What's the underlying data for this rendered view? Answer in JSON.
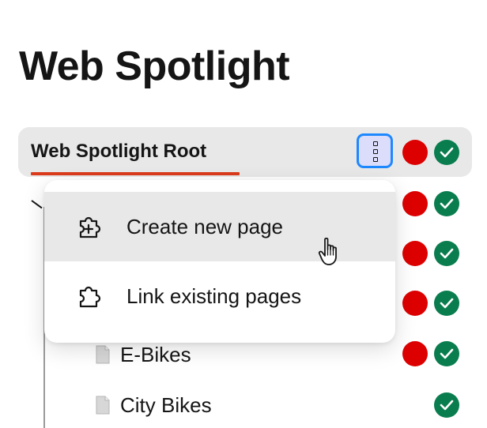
{
  "page": {
    "title": "Web Spotlight"
  },
  "root": {
    "label": "Web Spotlight Root",
    "more_icon": "vertical-dots-icon",
    "status": {
      "unpublished_icon": "red-dot-icon",
      "published_icon": "check-circle-icon"
    }
  },
  "context_menu": {
    "items": [
      {
        "label": "Create new page",
        "icon": "puzzle-plus-icon"
      },
      {
        "label": "Link existing pages",
        "icon": "puzzle-icon"
      }
    ]
  },
  "tree": {
    "items": [
      {
        "label": "E-Bikes",
        "icon": "page-icon"
      },
      {
        "label": "City Bikes",
        "icon": "page-icon"
      }
    ]
  },
  "colors": {
    "accent_underline": "#db3b1b",
    "focus_ring": "#1e88ff",
    "status_red": "#dd0000",
    "status_green": "#0a7d4e",
    "row_hover": "#e8e8e8"
  }
}
